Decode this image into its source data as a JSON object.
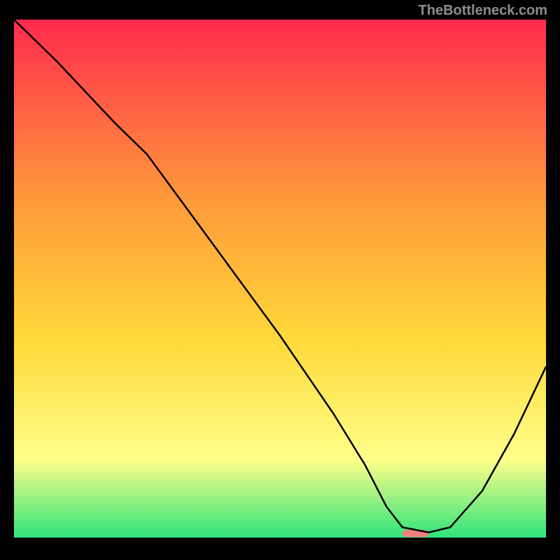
{
  "watermark": "TheBottleneck.com",
  "chart_data": {
    "type": "line",
    "title": "",
    "xlabel": "",
    "ylabel": "",
    "xlim": [
      0,
      100
    ],
    "ylim": [
      0,
      100
    ],
    "grid": false,
    "legend": false,
    "background_gradient": {
      "top_color": "#ff2b4d",
      "mid_upper_color": "#ff9a3a",
      "mid_color": "#ffd93a",
      "lower_color": "#ffff8a",
      "bottom_color": "#2fe37a"
    },
    "series": [
      {
        "name": "bottleneck-curve",
        "color": "#000000",
        "x": [
          0,
          8,
          19,
          25,
          30,
          40,
          50,
          60,
          66,
          70,
          73,
          78,
          82,
          88,
          94,
          100
        ],
        "values": [
          100,
          92,
          80,
          74,
          67,
          53,
          39,
          24,
          14,
          6,
          2,
          1,
          2,
          9,
          20,
          33
        ]
      }
    ],
    "marker": {
      "name": "optimal-range",
      "color": "#f08080",
      "x_start": 73,
      "x_end": 78,
      "y": 0.8
    }
  }
}
